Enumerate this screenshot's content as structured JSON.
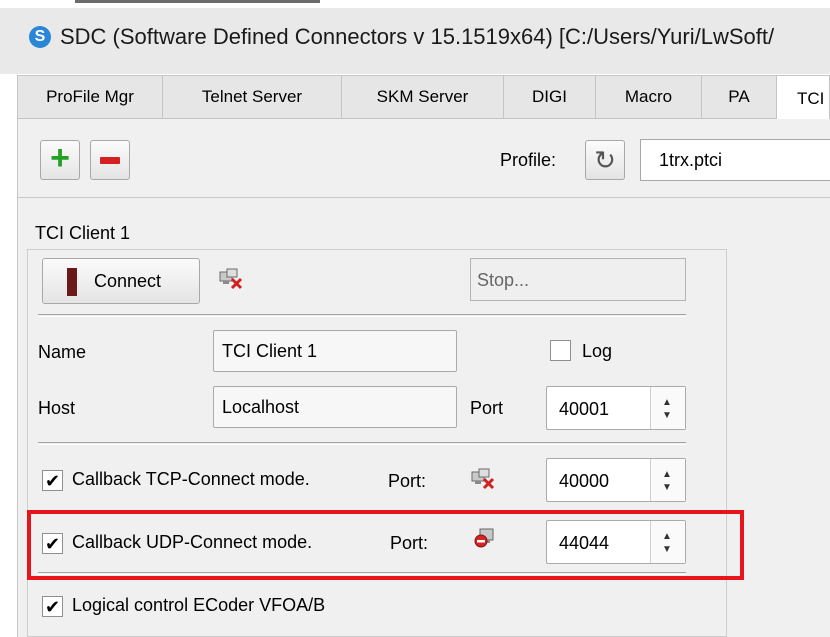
{
  "window": {
    "title": "SDC (Software Defined Connectors v 15.1519x64) [C:/Users/Yuri/LwSoft/",
    "logo_letter": "S"
  },
  "tabs": [
    {
      "label": "ProFile Mgr"
    },
    {
      "label": "Telnet Server"
    },
    {
      "label": "SKM Server"
    },
    {
      "label": "DIGI"
    },
    {
      "label": "Macro"
    },
    {
      "label": "PA"
    },
    {
      "label": "TCI"
    }
  ],
  "toolbar": {
    "add_glyph": "+",
    "profile_label": "Profile:",
    "refresh_glyph": "↻",
    "profile_value": "1trx.ptci"
  },
  "client": {
    "group_title": "TCI Client 1",
    "connect_label": "Connect",
    "stop_placeholder": "Stop...",
    "name_label": "Name",
    "name_value": "TCI Client 1",
    "log_label": "Log",
    "host_label": "Host",
    "host_value": "Localhost",
    "port_label": "Port",
    "port_value": "40001",
    "tcp_label": "Callback TCP-Connect mode.",
    "tcp_port_label": "Port:",
    "tcp_port_value": "40000",
    "udp_label": "Callback UDP-Connect mode.",
    "udp_port_label": "Port:",
    "udp_port_value": "44044",
    "ecoder_label": "Logical control ECoder VFOA/B",
    "check_glyph": "✔"
  },
  "colors": {
    "highlight": "#e8141b",
    "add_button": "#22a122",
    "remove_button": "#d42020"
  }
}
